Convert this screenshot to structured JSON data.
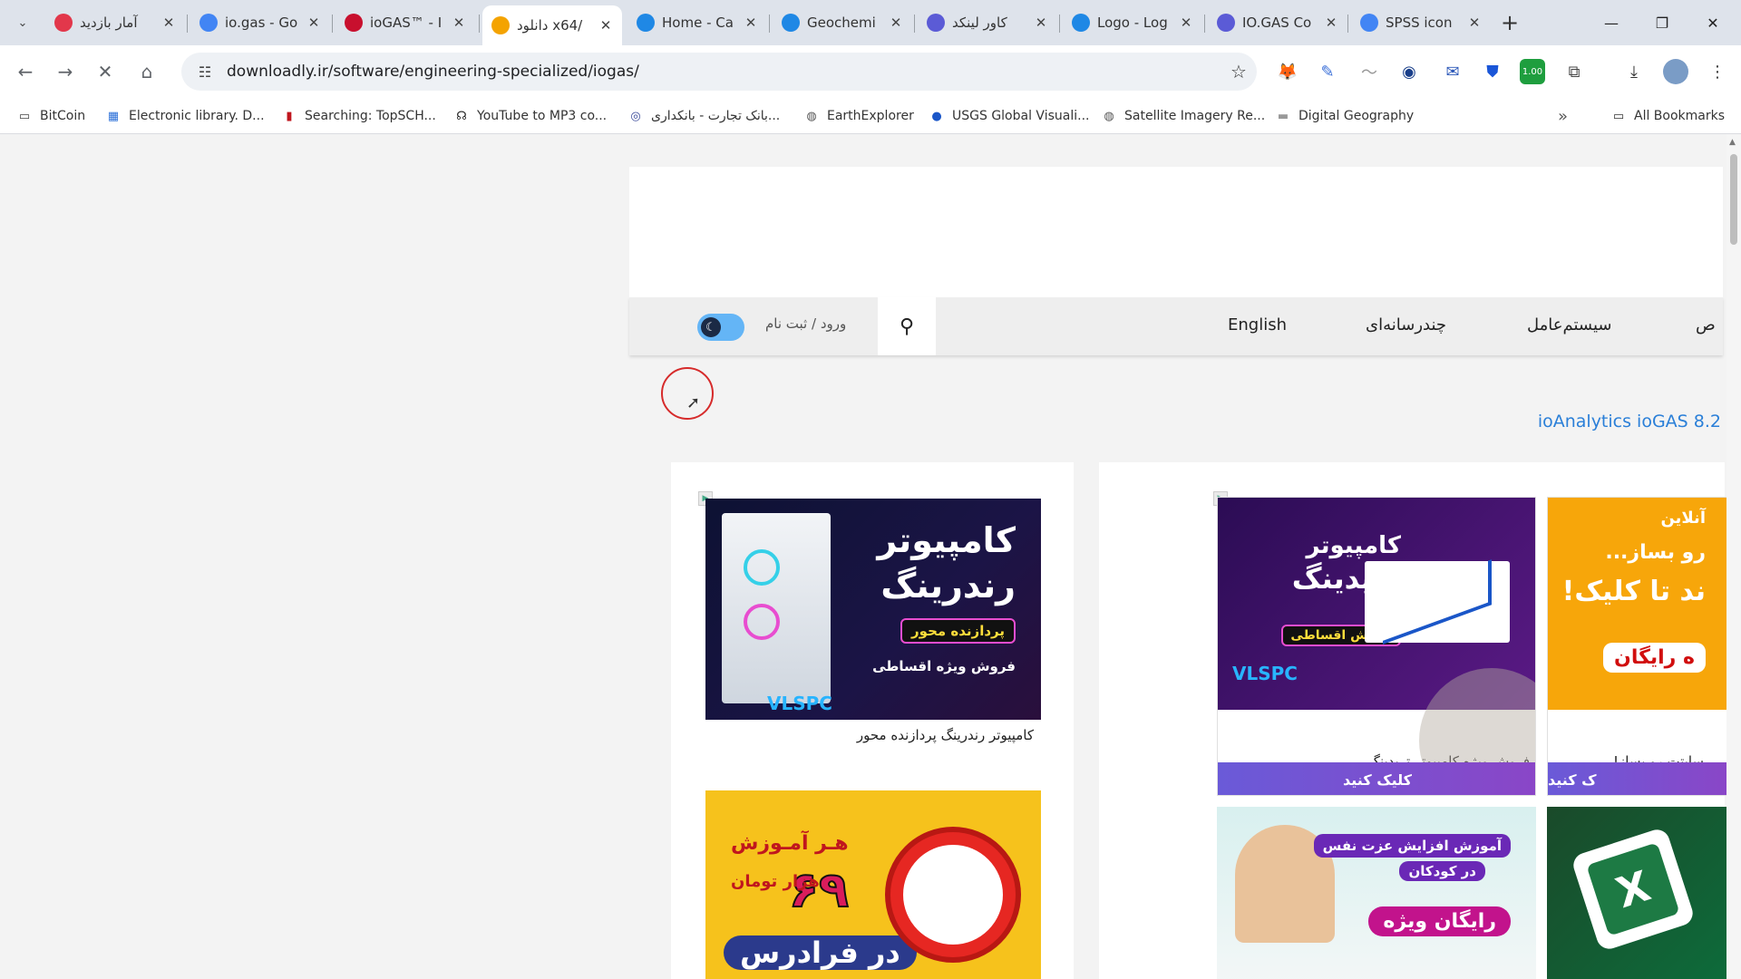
{
  "tabs": [
    {
      "title": "آمار بازدید",
      "favicon": "stats-favicon",
      "color": "#e2374b",
      "active": false
    },
    {
      "title": "io.gas - Go",
      "favicon": "google-favicon",
      "color": "#4285f4",
      "active": false
    },
    {
      "title": "ioGAS™ - I",
      "favicon": "imdex-favicon",
      "color": "#c8102e",
      "active": false
    },
    {
      "title": "دانلود x64/",
      "favicon": "downloadly-favicon",
      "color": "#f4a300",
      "active": true
    },
    {
      "title": "Home - Ca",
      "favicon": "canva-favicon",
      "color": "#1f88e5",
      "active": false
    },
    {
      "title": "Geochemi",
      "favicon": "canva-favicon",
      "color": "#1f88e5",
      "active": false
    },
    {
      "title": "کاور لینکد",
      "favicon": "bookmark-favicon",
      "color": "#5b5bd6",
      "active": false
    },
    {
      "title": "Logo - Log",
      "favicon": "canva-favicon",
      "color": "#1f88e5",
      "active": false
    },
    {
      "title": "IO.GAS Co",
      "favicon": "bookmark-favicon",
      "color": "#5b5bd6",
      "active": false
    },
    {
      "title": "SPSS icon",
      "favicon": "google-favicon",
      "color": "#4285f4",
      "active": false
    }
  ],
  "address": {
    "url": "downloadly.ir/software/engineering-specialized/iogas/"
  },
  "bookmarks": [
    {
      "label": "BitCoin",
      "icon": "folder-icon"
    },
    {
      "label": "Electronic library. D...",
      "icon": "library-icon"
    },
    {
      "label": "Searching: TopSCH...",
      "icon": "topsch-icon"
    },
    {
      "label": "YouTube to MP3 co...",
      "icon": "headphones-icon"
    },
    {
      "label": "بانک تجارت - بانکداری...",
      "icon": "bank-icon"
    },
    {
      "label": "EarthExplorer",
      "icon": "globe-icon"
    },
    {
      "label": "USGS Global Visuali...",
      "icon": "earth-icon"
    },
    {
      "label": "Satellite Imagery Re...",
      "icon": "globe-icon"
    },
    {
      "label": "Digital Geography",
      "icon": "image-icon"
    }
  ],
  "all_bookmarks": "All Bookmarks",
  "site": {
    "login_label": "ورود / ثبت نام",
    "nav": [
      "English",
      "چندرسانه‌ای",
      "سیستم‌عامل",
      "ص"
    ],
    "product_title": "ioAnalytics ioGAS 8.2"
  },
  "ads": {
    "left1": {
      "headline1": "کامپیوتر",
      "headline2": "رندرینگ",
      "tag": "پردازنده محور",
      "sub": "فروش ویژه اقساطی",
      "brand": "VLSPC",
      "caption": "کامپیوتر رندرینگ پردازنده محور"
    },
    "left2": {
      "line1": "هـر آمـوزش",
      "number": "۶۹",
      "line2": "هزار تومان",
      "line3": "در فرادرس"
    },
    "right1": {
      "headline1": "کامپیوتر",
      "headline2": "تریدینگ",
      "tag": "فروش اقساطی",
      "brand": "VLSPC",
      "caption": "فروش ویژه کامپیوتر تریدینگ",
      "cta": "کلیک کنید"
    },
    "right2": {
      "line1": "آنلاین",
      "line2": "رو بساز...",
      "line3": "ند تا کلیک!",
      "line4": "ه رایگان",
      "caption": "سایتت رو بساز!",
      "cta": "ک کنید"
    },
    "right3": {
      "line1": "آموزش افزایش عزت نفس",
      "line2": "در کودکان",
      "line3": "رایگان ویژه"
    }
  }
}
